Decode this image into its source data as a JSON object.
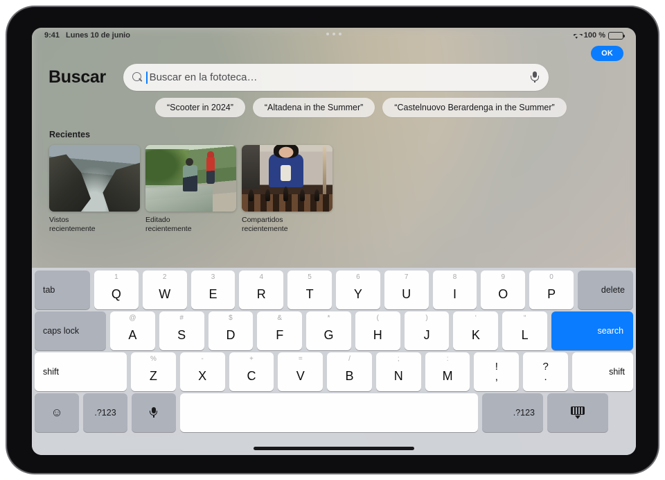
{
  "status_bar": {
    "time": "9:41",
    "date": "Lunes 10 de junio",
    "wifi_icon": "wifi-icon",
    "battery_percent": "100 %",
    "battery_icon": "battery-icon",
    "multitask_handle": "multitask-dots-icon"
  },
  "ok_button": {
    "label": "OK",
    "color": "#0a7cff"
  },
  "header": {
    "title": "Buscar",
    "search": {
      "icon": "search-icon",
      "placeholder": "Buscar en la fototeca…",
      "value": "",
      "dictation_icon": "microphone-icon"
    }
  },
  "suggestions": [
    {
      "label": "“Scooter in 2024”"
    },
    {
      "label": "“Altadena in the Summer”"
    },
    {
      "label": "“Castelnuovo Berardenga in the Summer”"
    }
  ],
  "recents": {
    "title": "Recientes",
    "cards": [
      {
        "label": "Vistos\nrecientemente",
        "image": "coastal-cliffs-photo"
      },
      {
        "label": "Editado\nrecientemente",
        "image": "stream-hikers-photo"
      },
      {
        "label": "Compartidos\nrecientemente",
        "image": "girl-playing-chess-photo"
      }
    ]
  },
  "keyboard": {
    "row1": {
      "tab": "tab",
      "keys": [
        {
          "alt": "1",
          "main": "Q"
        },
        {
          "alt": "2",
          "main": "W"
        },
        {
          "alt": "3",
          "main": "E"
        },
        {
          "alt": "4",
          "main": "R"
        },
        {
          "alt": "5",
          "main": "T"
        },
        {
          "alt": "6",
          "main": "Y"
        },
        {
          "alt": "7",
          "main": "U"
        },
        {
          "alt": "8",
          "main": "I"
        },
        {
          "alt": "9",
          "main": "O"
        },
        {
          "alt": "0",
          "main": "P"
        }
      ],
      "delete": "delete"
    },
    "row2": {
      "caps_lock": "caps lock",
      "keys": [
        {
          "alt": "@",
          "main": "A"
        },
        {
          "alt": "#",
          "main": "S"
        },
        {
          "alt": "$",
          "main": "D"
        },
        {
          "alt": "&",
          "main": "F"
        },
        {
          "alt": "*",
          "main": "G"
        },
        {
          "alt": "(",
          "main": "H"
        },
        {
          "alt": ")",
          "main": "J"
        },
        {
          "alt": "‘",
          "main": "K"
        },
        {
          "alt": "“",
          "main": "L"
        }
      ],
      "return": "search"
    },
    "row3": {
      "shift_left": "shift",
      "keys": [
        {
          "alt": "%",
          "main": "Z"
        },
        {
          "alt": "-",
          "main": "X"
        },
        {
          "alt": "+",
          "main": "C"
        },
        {
          "alt": "=",
          "main": "V"
        },
        {
          "alt": "/",
          "main": "B"
        },
        {
          "alt": ";",
          "main": "N"
        },
        {
          "alt": ":",
          "main": "M"
        }
      ],
      "punct": [
        {
          "top": "!",
          "bottom": ","
        },
        {
          "top": "?",
          "bottom": "."
        }
      ],
      "shift_right": "shift"
    },
    "row4": {
      "emoji_icon": "emoji-icon",
      "numbers_left": ".?123",
      "dictation_icon": "microphone-icon",
      "space": "",
      "numbers_right": ".?123",
      "hide_keyboard_icon": "hide-keyboard-icon"
    }
  }
}
